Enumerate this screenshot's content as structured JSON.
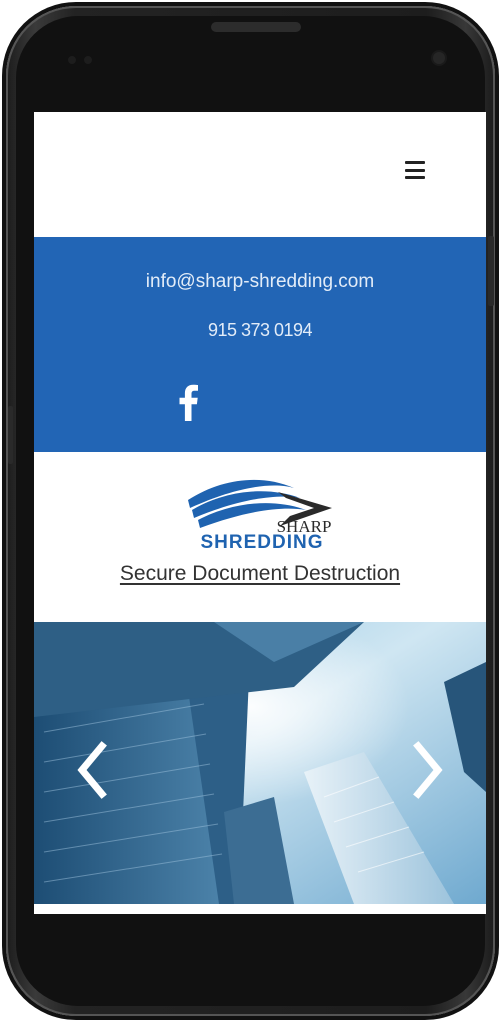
{
  "header": {
    "menu_icon": "hamburger-menu-icon"
  },
  "contact": {
    "email": "info@sharp-shredding.com",
    "phone": "915 373 0194",
    "social_icon": "facebook-icon",
    "background_color": "#2265b5"
  },
  "brand": {
    "logo_word_top": "SHARP",
    "logo_word_bottom": "SHREDDING",
    "tagline": "Secure Document Destruction",
    "logo_color": "#1f63b0"
  },
  "hero": {
    "prev_icon": "chevron-left-icon",
    "next_icon": "chevron-right-icon"
  }
}
